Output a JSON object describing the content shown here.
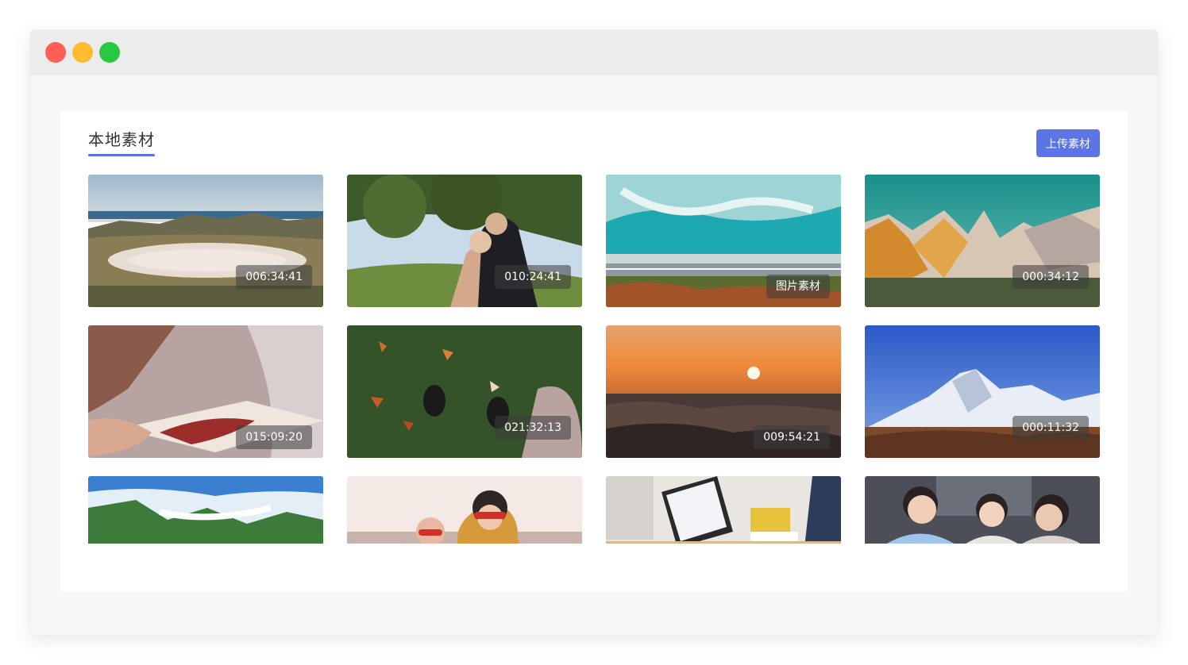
{
  "window": {
    "controls": [
      "close",
      "minimize",
      "maximize"
    ]
  },
  "panel": {
    "tab_title": "本地素材",
    "upload_label": "上传素材"
  },
  "accent_color": "#5b75e6",
  "items": [
    {
      "subject": "salt lake valley landscape",
      "badge": "006:34:41"
    },
    {
      "subject": "couple under tree",
      "badge": "010:24:41"
    },
    {
      "subject": "aerial turquoise coast and road",
      "badge": "图片素材"
    },
    {
      "subject": "golden mountain peaks",
      "badge": "000:34:12"
    },
    {
      "subject": "open book with red maple leaf",
      "badge": "015:09:20"
    },
    {
      "subject": "autumn leaves on grass with shoes",
      "badge": "021:32:13"
    },
    {
      "subject": "sunset over ocean waves",
      "badge": "009:54:21"
    },
    {
      "subject": "snowy mountain range under blue sky",
      "badge": "000:11:32"
    },
    {
      "subject": "green mountains above clouds",
      "badge": ""
    },
    {
      "subject": "friends in sunglasses outdoors",
      "badge": ""
    },
    {
      "subject": "laptop on desk with books",
      "badge": ""
    },
    {
      "subject": "colleagues smiling in office",
      "badge": ""
    }
  ]
}
